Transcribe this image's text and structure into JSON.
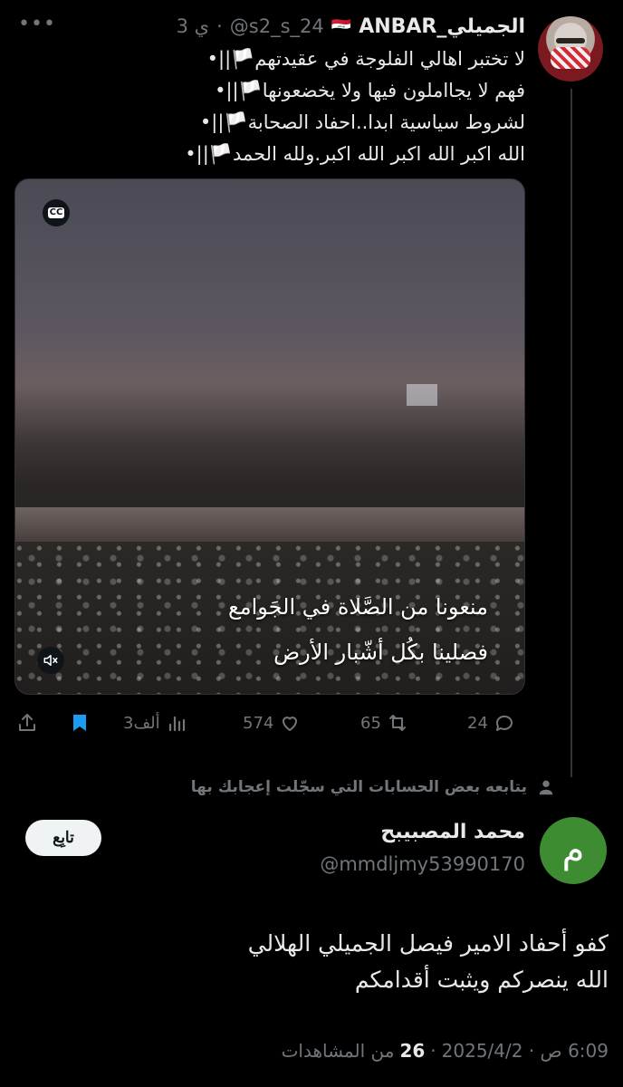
{
  "top_tweet": {
    "display_name": "الجميلي_ANBAR",
    "flag": "🇮🇶",
    "handle": "@s2_s_24",
    "time": "3 ي",
    "lines": [
      "لا تختبر اهالي الفلوجة في عقيدتهم🏳️||•",
      "فهم لا يجااملون فيها ولا يخضعونها🏳️||•",
      "لشروط سياسية ابدا..احفاد الصحابة🏳️||•",
      "الله اكبر الله اكبر الله اكبر.ولله الحمد🏳️||•"
    ],
    "video": {
      "cc_label": "CC",
      "caption_line_1": "منعونا من الصَّلاة في الجَوامع",
      "caption_line_2": "فصلينا بكُل أشّبار الأرض"
    },
    "actions": {
      "replies": "24",
      "reposts": "65",
      "likes": "574",
      "views": "3ألف"
    }
  },
  "social_context": "يتابعه بعض الحسابات التي سجّلت إعجابك بها",
  "reply": {
    "avatar_letter": "م",
    "display_name": "محمد المصبيبح",
    "handle": "@mmdljmy53990170",
    "follow_label": "تابِع",
    "text_line_1": "كفو أحفاد الامير فيصل الجميلي الهلالي",
    "text_line_2": "الله ينصركم ويثبت أقدامكم",
    "timestamp": "6:09 ص · 2025/4/2",
    "views_count": "26",
    "views_label": "من المشاهدات"
  },
  "colors": {
    "background": "#000000",
    "text": "#e7e9ea",
    "muted": "#71767b",
    "bookmark_active": "#1d9bf0",
    "avatar_green": "#3d8c32"
  }
}
